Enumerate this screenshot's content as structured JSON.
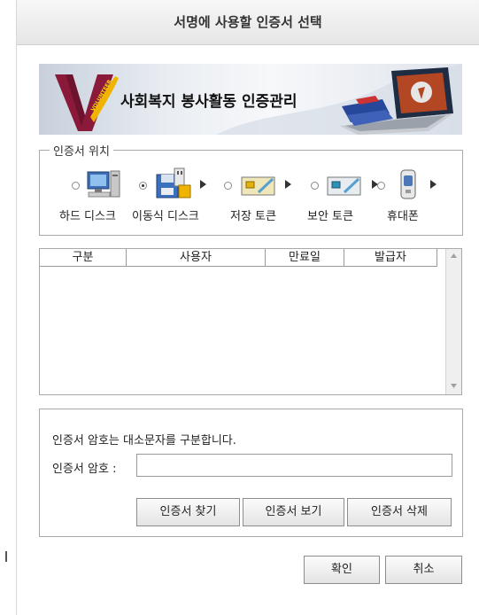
{
  "dialog": {
    "title": "서명에 사용할 인증서 선택"
  },
  "banner": {
    "title": "사회복지 봉사활동 인증관리",
    "logo_text": "VOLUNTEER"
  },
  "location": {
    "legend": "인증서 위치",
    "devices": [
      {
        "label": "하드 디스크",
        "icon": "hard-disk-icon",
        "selected": false
      },
      {
        "label": "이동식 디스크",
        "icon": "removable-disk-icon",
        "selected": true
      },
      {
        "label": "저장 토큰",
        "icon": "storage-token-icon",
        "selected": false
      },
      {
        "label": "보안 토큰",
        "icon": "security-token-icon",
        "selected": false
      },
      {
        "label": "휴대폰",
        "icon": "mobile-phone-icon",
        "selected": false
      }
    ]
  },
  "cert_table": {
    "columns": [
      "구분",
      "사용자",
      "만료일",
      "발급자"
    ],
    "rows": []
  },
  "password": {
    "notice": "인증서 암호는 대소문자를 구분합니다.",
    "label": "인증서 암호 :",
    "value": ""
  },
  "buttons": {
    "find": "인증서 찾기",
    "view": "인증서 보기",
    "delete": "인증서 삭제",
    "ok": "확인",
    "cancel": "취소"
  }
}
